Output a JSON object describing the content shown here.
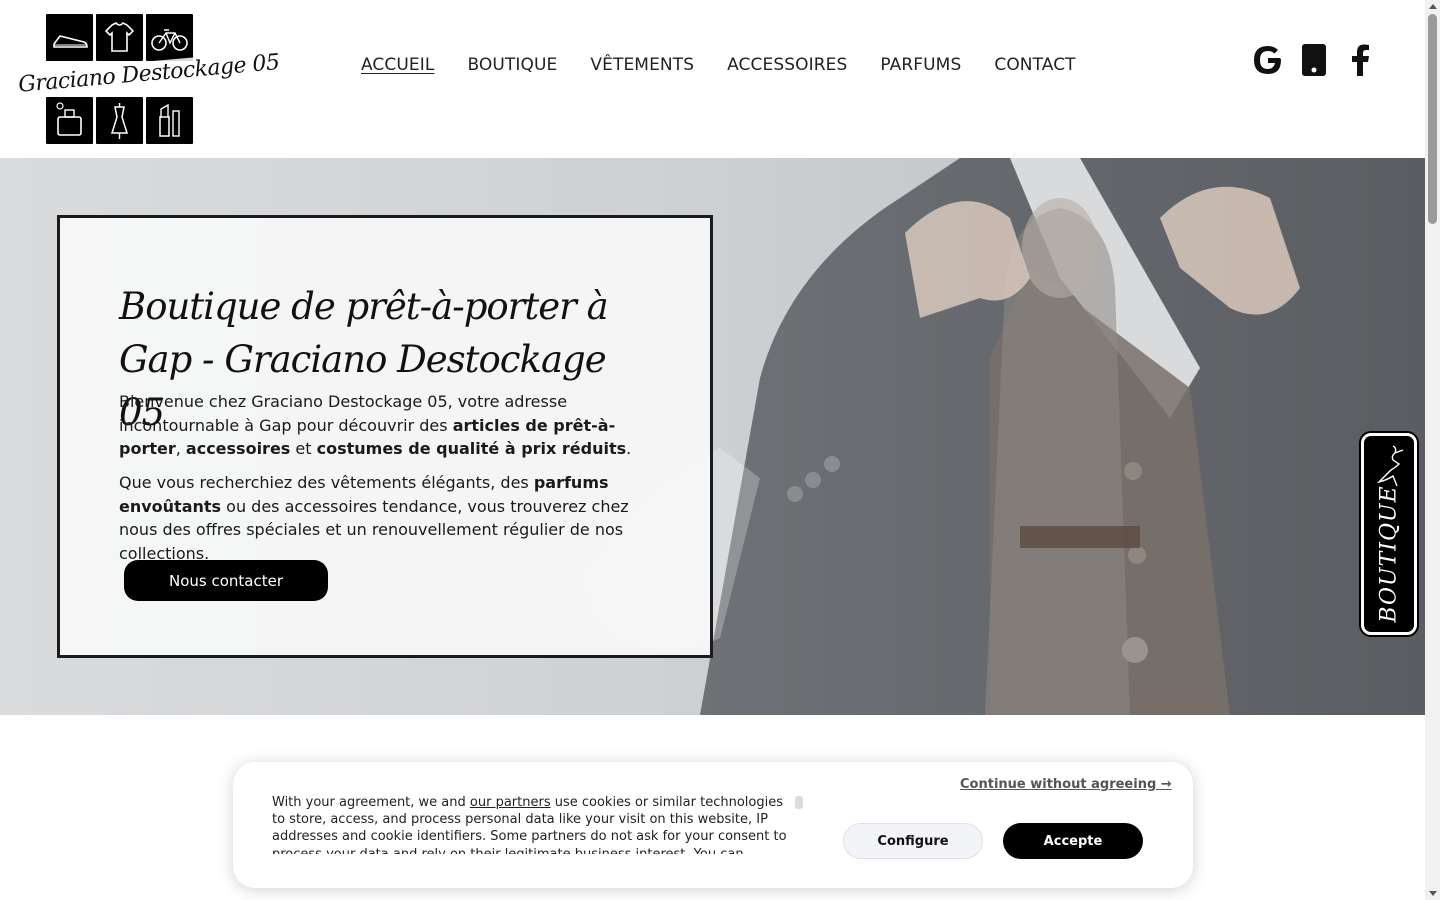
{
  "brand": {
    "name": "Graciano Destockage 05"
  },
  "nav": {
    "items": [
      {
        "label": "ACCUEIL",
        "active": true
      },
      {
        "label": "BOUTIQUE",
        "active": false
      },
      {
        "label": "VÊTEMENTS",
        "active": false
      },
      {
        "label": "ACCESSOIRES",
        "active": false
      },
      {
        "label": "PARFUMS",
        "active": false
      },
      {
        "label": "CONTACT",
        "active": false
      }
    ]
  },
  "socials": [
    {
      "icon": "google-icon"
    },
    {
      "icon": "mobile-phone-icon"
    },
    {
      "icon": "facebook-icon"
    }
  ],
  "hero": {
    "title": "Boutique de prêt-à-porter à Gap - Graciano Destockage 05",
    "paragraph1": {
      "t1": "Bienvenue chez Graciano Destockage 05, votre adresse incontournable à Gap pour découvrir des ",
      "b1": "articles de prêt-à-porter",
      "t2": ", ",
      "b2": "accessoires",
      "t3": " et ",
      "b3": "costumes de qualité à prix réduits",
      "t4": "."
    },
    "paragraph2": {
      "t1": "Que vous recherchiez des vêtements élégants, des ",
      "b1": "parfums envoûtants",
      "t2": " ou des accessoires tendance, vous trouverez chez nous des offres spéciales et un renouvellement régulier de nos collections."
    },
    "cta_label": "Nous contacter"
  },
  "side_tab": {
    "label": "BOUTIQUE"
  },
  "cookie": {
    "text_before": "With your agreement, we and ",
    "partners_link": "our partners",
    "text_after": " use cookies or similar technologies to store, access, and process personal data like your visit on this website, IP addresses and cookie identifiers. Some partners do not ask for your consent to process your data and rely on their legitimate business interest. You can",
    "continue_label": "Continue without agreeing →",
    "configure_label": "Configure",
    "accept_label": "Accepte"
  },
  "colors": {
    "accent": "#000000",
    "nav_text": "#222222",
    "card_bg": "#f8f8f8",
    "hero_bg": "#cfd2d5"
  }
}
